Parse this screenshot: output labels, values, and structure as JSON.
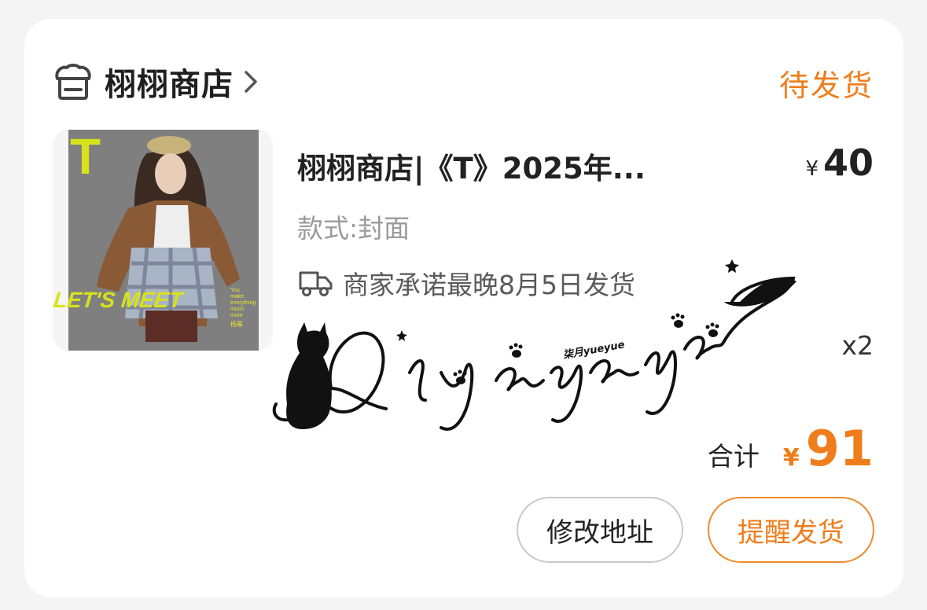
{
  "shop": {
    "name": "栩栩商店",
    "icon": "shop-icon",
    "chevron": "chevron-right-icon"
  },
  "order": {
    "status": "待发货"
  },
  "product": {
    "title": "栩栩商店|《T》2025年...",
    "price_currency": "¥",
    "price": "40",
    "variant": "款式:封面",
    "promise": "商家承诺最晚8月5日发货",
    "quantity": "x2",
    "cover": {
      "masthead": "T",
      "headline": "LET'S MEET",
      "tagline_lines": [
        "You",
        "make",
        "everything",
        "much",
        "more"
      ],
      "name": "杨幂"
    }
  },
  "total": {
    "label": "合计",
    "currency": "¥",
    "amount": "91"
  },
  "actions": {
    "modify_address": "修改地址",
    "remind_shipping": "提醒发货"
  },
  "watermark": {
    "script": "Qiyaeyaeyae",
    "tag": "柒月yueyue"
  },
  "colors": {
    "accent": "#f07d1b",
    "background": "#f4f4f4",
    "card": "#ffffff",
    "muted_text": "#9a9a9a",
    "cover_yellow": "#d8e21b"
  }
}
